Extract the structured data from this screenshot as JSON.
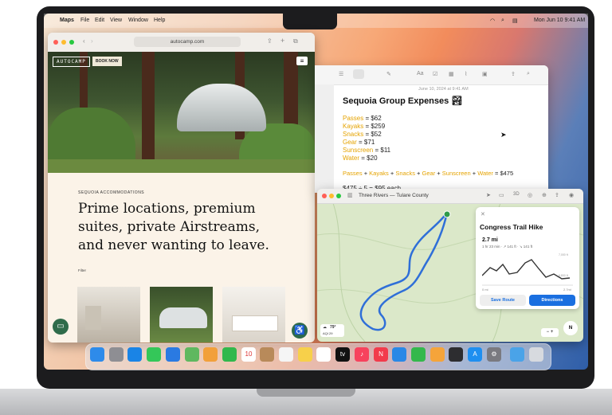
{
  "menubar": {
    "app": "Maps",
    "items": [
      "File",
      "Edit",
      "View",
      "Window",
      "Help"
    ],
    "datetime": "Mon Jun 10 9:41 AM"
  },
  "safari": {
    "url": "autocamp.com",
    "logo": "AUTOCAMP",
    "book_now": "BOOK NOW",
    "menu_glyph": "≡",
    "kicker": "SEQUOIA ACCOMMODATIONS",
    "headline": "Prime locations, premium suites, private Airstreams, and never wanting to leave.",
    "filter": "Filter"
  },
  "notes": {
    "date": "June 10, 2024 at 9:41 AM",
    "title": "Sequoia Group Expenses 🏞",
    "lines": [
      {
        "k": "Passes",
        "v": " = $62"
      },
      {
        "k": "Kayaks",
        "v": " = $259"
      },
      {
        "k": "Snacks",
        "v": " = $52"
      },
      {
        "k": "Gear",
        "v": " = $71"
      },
      {
        "k": "Sunscreen",
        "v": " = $11"
      },
      {
        "k": "Water",
        "v": " = $20"
      }
    ],
    "sum_parts": [
      "Passes",
      " + ",
      "Kayaks",
      " + ",
      "Snacks",
      " + ",
      "Gear",
      " + ",
      "Sunscreen",
      " + ",
      "Water",
      " = $475"
    ],
    "split_line": "$475 ÷ 5 = $95 each"
  },
  "maps": {
    "title": "Three Rivers — Tulare County",
    "hike": {
      "title": "Congress Trail Hike",
      "distance": "2.7 mi",
      "stats": "1 hr 23 min · ↗ 141 ft · ↘ 141 ft",
      "elev_high": "7,000 ft",
      "elev_low": "6,800 ft",
      "x_start": "0 mi",
      "x_end": "2.7mi",
      "save_route": "Save Route",
      "directions": "Directions"
    },
    "weather_temp": "79°",
    "aqi": "AQI 29",
    "compass": "N",
    "zoom": "− +"
  },
  "dock": {
    "items": [
      {
        "name": "finder",
        "color": "#2e8bea"
      },
      {
        "name": "launchpad",
        "color": "#8e8e93"
      },
      {
        "name": "safari",
        "color": "#1a84e6"
      },
      {
        "name": "messages",
        "color": "#34c759"
      },
      {
        "name": "mail",
        "color": "#2a7ae2"
      },
      {
        "name": "maps",
        "color": "#5fb85f"
      },
      {
        "name": "photos",
        "color": "#f2a03a"
      },
      {
        "name": "facetime",
        "color": "#31b84c"
      },
      {
        "name": "calendar",
        "color": "#ffffff",
        "text": "10"
      },
      {
        "name": "contacts",
        "color": "#b88a5a"
      },
      {
        "name": "reminders",
        "color": "#f5f5f5"
      },
      {
        "name": "notes",
        "color": "#f7d04a"
      },
      {
        "name": "freeform",
        "color": "#ffffff"
      },
      {
        "name": "tv",
        "color": "#111111",
        "text": "tv"
      },
      {
        "name": "music",
        "color": "#f7425d",
        "text": "♪"
      },
      {
        "name": "news",
        "color": "#f23b4b",
        "text": "N"
      },
      {
        "name": "keynote",
        "color": "#2a88e6"
      },
      {
        "name": "numbers",
        "color": "#34b84c"
      },
      {
        "name": "pages",
        "color": "#f5a43a"
      },
      {
        "name": "iphone-mirroring",
        "color": "#2d2d30"
      },
      {
        "name": "app-store",
        "color": "#1e8ff0",
        "text": "A"
      },
      {
        "name": "system-settings",
        "color": "#7a7a80",
        "text": "⚙"
      },
      {
        "name": "downloads",
        "color": "#4aa3e8"
      },
      {
        "name": "trash",
        "color": "#d7dadf"
      }
    ]
  }
}
